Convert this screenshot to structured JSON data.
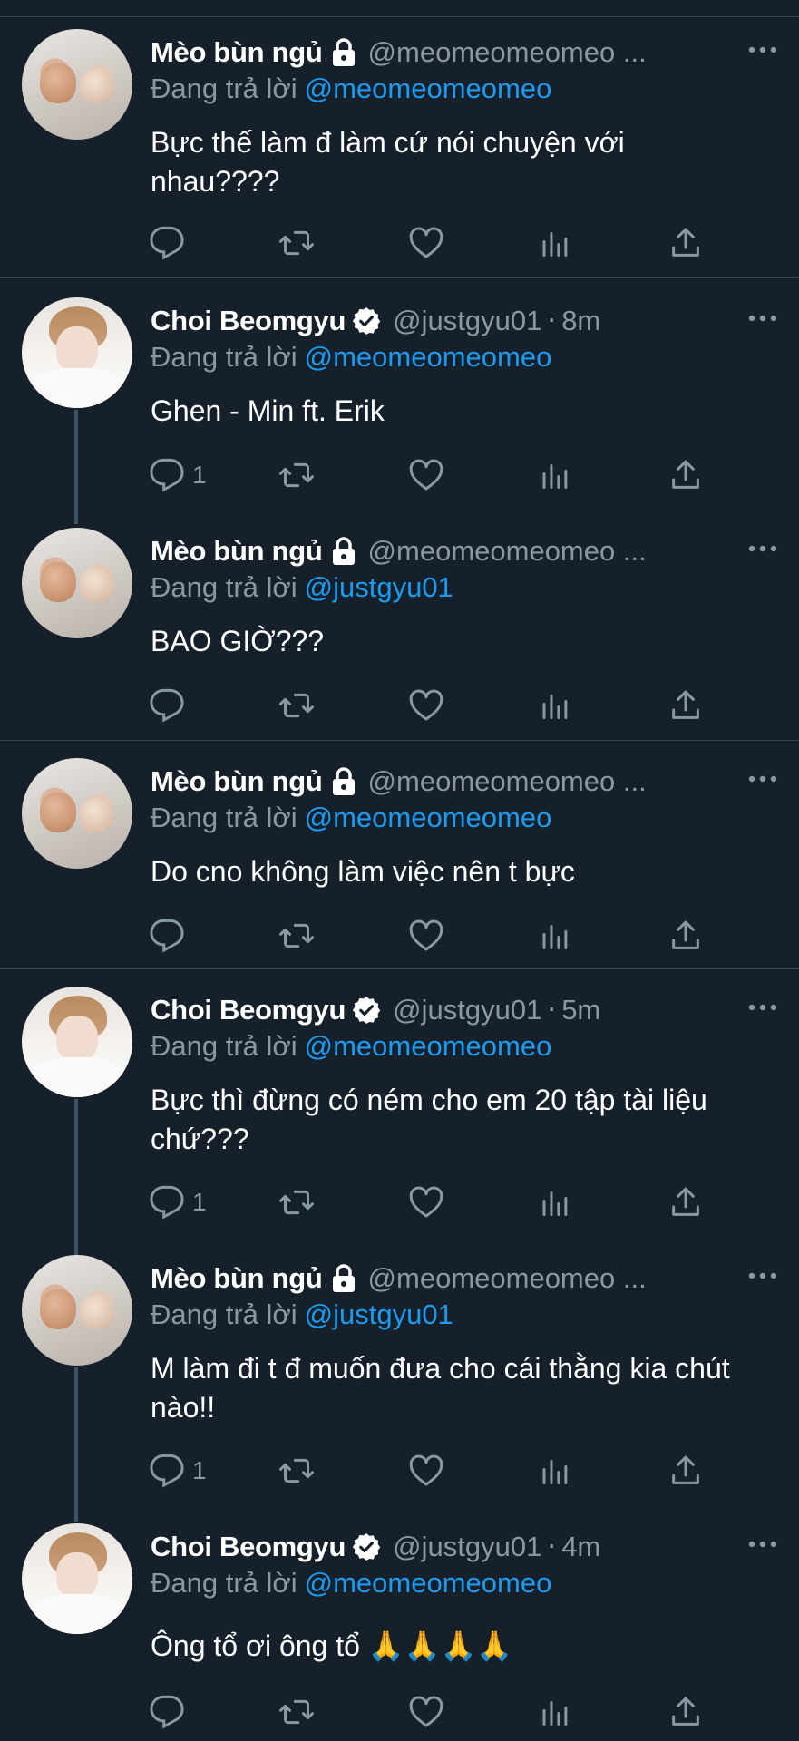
{
  "reply_prefix": "Đang trả lời",
  "colors": {
    "background": "#15202b",
    "secondary": "#8899a6",
    "link": "#1d9bf0",
    "divider": "#38444d"
  },
  "icons": [
    "lock-icon",
    "verified-icon",
    "more-icon",
    "reply-icon",
    "retweet-icon",
    "like-icon",
    "views-icon",
    "share-icon"
  ],
  "tweets": [
    {
      "name": "Mèo bùn ngủ",
      "handle": "@meomeomeomeo ...",
      "time": "",
      "reply_to": "@meomeomeomeo",
      "text": "Bực thế làm đ làm cứ nói chuyện với nhau????",
      "reply_count": ""
    },
    {
      "name": "Choi Beomgyu",
      "handle": "@justgyu01",
      "time": "8m",
      "reply_to": "@meomeomeomeo",
      "text": "Ghen - Min ft. Erik",
      "reply_count": "1"
    },
    {
      "name": "Mèo bùn ngủ",
      "handle": "@meomeomeomeo ...",
      "time": "",
      "reply_to": "@justgyu01",
      "text": "BAO GIỜ???",
      "reply_count": ""
    },
    {
      "name": "Mèo bùn ngủ",
      "handle": "@meomeomeomeo ...",
      "time": "",
      "reply_to": "@meomeomeomeo",
      "text": "Do cno không làm việc nên t bực",
      "reply_count": ""
    },
    {
      "name": "Choi Beomgyu",
      "handle": "@justgyu01",
      "time": "5m",
      "reply_to": "@meomeomeomeo",
      "text": "Bực thì đừng có ném cho em 20 tập tài liệu chứ???",
      "reply_count": "1"
    },
    {
      "name": "Mèo bùn ngủ",
      "handle": "@meomeomeomeo ...",
      "time": "",
      "reply_to": "@justgyu01",
      "text": "M làm đi t đ muốn đưa cho cái thằng kia chút nào!!",
      "reply_count": "1"
    },
    {
      "name": "Choi Beomgyu",
      "handle": "@justgyu01",
      "time": "4m",
      "reply_to": "@meomeomeomeo",
      "text": "Ông tổ ơi ông tổ 🙏🙏🙏🙏",
      "reply_count": ""
    }
  ]
}
